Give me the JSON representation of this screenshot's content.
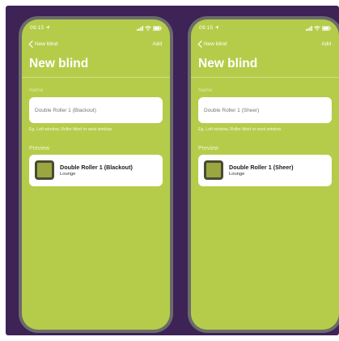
{
  "colors": {
    "backdrop": "#3d2356",
    "screen": "#b5cc4a",
    "phone_frame": "#6b6b6b",
    "swatch_outer": "#4a4a32",
    "swatch_inner": "#9aa640"
  },
  "phones": [
    {
      "status_time": "09:15",
      "back_label": "New blind",
      "add_label": "Add",
      "title": "New blind",
      "name_label": "Name",
      "name_placeholder": "Double Roller 1 (Blackout)",
      "hint": "Eg. Left window, Roller blind or west window.",
      "preview_label": "Preview",
      "preview_name": "Double Roller 1 (Blackout)",
      "preview_room": "Lounge",
      "icons": [
        "location-arrow-icon",
        "signal-icon",
        "wifi-icon",
        "battery-icon",
        "chevron-left-icon",
        "blind-swatch-icon"
      ]
    },
    {
      "status_time": "09:15",
      "back_label": "New blind",
      "add_label": "Add",
      "title": "New blind",
      "name_label": "Name",
      "name_placeholder": "Double Roller 1 (Sheer)",
      "hint": "Eg. Left window, Roller blind or west window.",
      "preview_label": "Preview",
      "preview_name": "Double Roller 1 (Sheer)",
      "preview_room": "Lounge",
      "icons": [
        "location-arrow-icon",
        "signal-icon",
        "wifi-icon",
        "battery-icon",
        "chevron-left-icon",
        "blind-swatch-icon"
      ]
    }
  ]
}
